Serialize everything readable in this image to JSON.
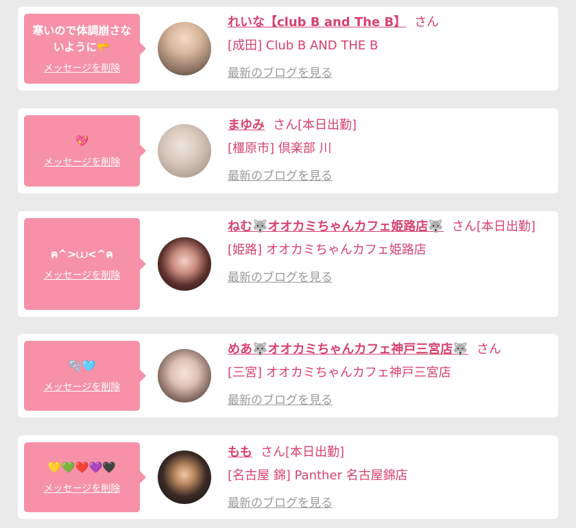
{
  "colors": {
    "bubble": "#f691a7",
    "accent": "#d8416d",
    "link_gray": "#9b9b9b",
    "background": "#eaeaea"
  },
  "cards": [
    {
      "message": "寒いので体調崩さないように🫳",
      "delete_label": "メッセージを削除",
      "name": "れいな【club B and The B】",
      "suffix": "さん",
      "shop": "[成田] Club B AND THE B",
      "blog_label": "最新のブログを見る"
    },
    {
      "message": "💖",
      "delete_label": "メッセージを削除",
      "name": "まゆみ",
      "suffix": "さん[本日出勤]",
      "shop": "[橿原市] 倶楽部 川",
      "blog_label": "最新のブログを見る"
    },
    {
      "message": "ฅ^>⩊<^ฅ",
      "delete_label": "メッセージを削除",
      "name": "ねむ🐺オオカミちゃんカフェ姫路店🐺",
      "suffix": "さん[本日出勤]",
      "shop": "[姫路] オオカミちゃんカフェ姫路店",
      "blog_label": "最新のブログを見る"
    },
    {
      "message": "🫧🩵",
      "delete_label": "メッセージを削除",
      "name": "めあ🐺オオカミちゃんカフェ神戸三宮店🐺",
      "suffix": "さん",
      "shop": "[三宮] オオカミちゃんカフェ神戸三宮店",
      "blog_label": "最新のブログを見る"
    },
    {
      "message": "💛💚❤️💜🖤",
      "delete_label": "メッセージを削除",
      "name": "もも",
      "suffix": "さん[本日出勤]",
      "shop": "[名古屋 錦] Panther 名古屋錦店",
      "blog_label": "最新のブログを見る"
    }
  ]
}
